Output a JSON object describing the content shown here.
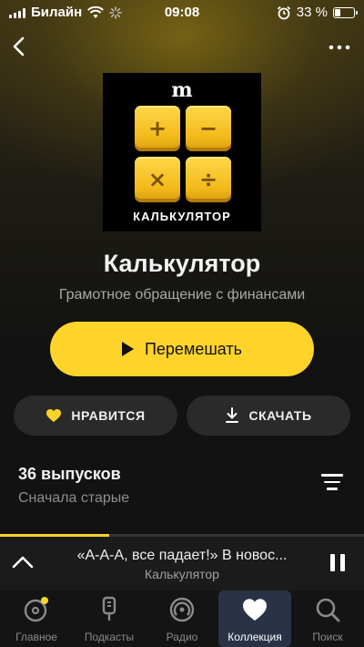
{
  "status_bar": {
    "carrier": "Билайн",
    "time": "09:08",
    "battery": "33 %",
    "battery_level": 0.33,
    "icons": [
      "signal-icon",
      "wifi-icon",
      "loading-icon",
      "alarm-icon",
      "battery-icon"
    ]
  },
  "header": {
    "back_icon": "chevron-left-icon",
    "more_icon": "more-horizontal-icon"
  },
  "cover": {
    "logo": "m",
    "keys": [
      "+",
      "−",
      "×",
      "÷"
    ],
    "title": "КАЛЬКУЛЯТОР",
    "key_color": "#f5c21e"
  },
  "podcast": {
    "title": "Калькулятор",
    "subtitle": "Грамотное обращение с финансами"
  },
  "actions": {
    "shuffle_label": "Перемешать",
    "like_label": "НРАВИТСЯ",
    "download_label": "СКАЧАТЬ",
    "accent_color": "#fed42b",
    "like_icon_color": "#fed42b"
  },
  "episodes": {
    "count_label": "36 выпусков",
    "sort_label": "Сначала старые"
  },
  "now_playing": {
    "title": "«А-А-А, все падает!» В новос...",
    "subtitle": "Калькулятор",
    "progress": 0.3
  },
  "tabs": [
    {
      "label": "Главное",
      "icon": "home-disc-icon",
      "active": false,
      "badge": true
    },
    {
      "label": "Подкасты",
      "icon": "microphone-icon",
      "active": false
    },
    {
      "label": "Радио",
      "icon": "radio-icon",
      "active": false
    },
    {
      "label": "Коллекция",
      "icon": "heart-icon",
      "active": true
    },
    {
      "label": "Поиск",
      "icon": "search-icon",
      "active": false
    }
  ]
}
